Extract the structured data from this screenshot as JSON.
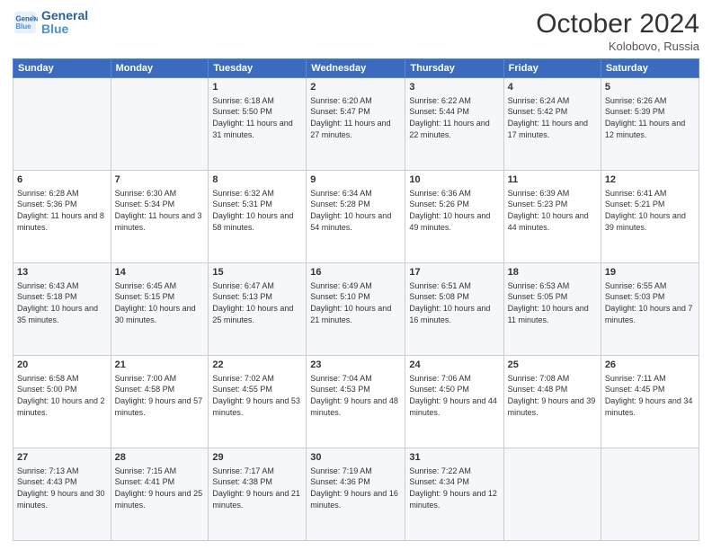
{
  "header": {
    "logo_line1": "General",
    "logo_line2": "Blue",
    "month": "October 2024",
    "location": "Kolobovo, Russia"
  },
  "days_of_week": [
    "Sunday",
    "Monday",
    "Tuesday",
    "Wednesday",
    "Thursday",
    "Friday",
    "Saturday"
  ],
  "weeks": [
    [
      {
        "day": "",
        "sunrise": "",
        "sunset": "",
        "daylight": ""
      },
      {
        "day": "",
        "sunrise": "",
        "sunset": "",
        "daylight": ""
      },
      {
        "day": "1",
        "sunrise": "Sunrise: 6:18 AM",
        "sunset": "Sunset: 5:50 PM",
        "daylight": "Daylight: 11 hours and 31 minutes."
      },
      {
        "day": "2",
        "sunrise": "Sunrise: 6:20 AM",
        "sunset": "Sunset: 5:47 PM",
        "daylight": "Daylight: 11 hours and 27 minutes."
      },
      {
        "day": "3",
        "sunrise": "Sunrise: 6:22 AM",
        "sunset": "Sunset: 5:44 PM",
        "daylight": "Daylight: 11 hours and 22 minutes."
      },
      {
        "day": "4",
        "sunrise": "Sunrise: 6:24 AM",
        "sunset": "Sunset: 5:42 PM",
        "daylight": "Daylight: 11 hours and 17 minutes."
      },
      {
        "day": "5",
        "sunrise": "Sunrise: 6:26 AM",
        "sunset": "Sunset: 5:39 PM",
        "daylight": "Daylight: 11 hours and 12 minutes."
      }
    ],
    [
      {
        "day": "6",
        "sunrise": "Sunrise: 6:28 AM",
        "sunset": "Sunset: 5:36 PM",
        "daylight": "Daylight: 11 hours and 8 minutes."
      },
      {
        "day": "7",
        "sunrise": "Sunrise: 6:30 AM",
        "sunset": "Sunset: 5:34 PM",
        "daylight": "Daylight: 11 hours and 3 minutes."
      },
      {
        "day": "8",
        "sunrise": "Sunrise: 6:32 AM",
        "sunset": "Sunset: 5:31 PM",
        "daylight": "Daylight: 10 hours and 58 minutes."
      },
      {
        "day": "9",
        "sunrise": "Sunrise: 6:34 AM",
        "sunset": "Sunset: 5:28 PM",
        "daylight": "Daylight: 10 hours and 54 minutes."
      },
      {
        "day": "10",
        "sunrise": "Sunrise: 6:36 AM",
        "sunset": "Sunset: 5:26 PM",
        "daylight": "Daylight: 10 hours and 49 minutes."
      },
      {
        "day": "11",
        "sunrise": "Sunrise: 6:39 AM",
        "sunset": "Sunset: 5:23 PM",
        "daylight": "Daylight: 10 hours and 44 minutes."
      },
      {
        "day": "12",
        "sunrise": "Sunrise: 6:41 AM",
        "sunset": "Sunset: 5:21 PM",
        "daylight": "Daylight: 10 hours and 39 minutes."
      }
    ],
    [
      {
        "day": "13",
        "sunrise": "Sunrise: 6:43 AM",
        "sunset": "Sunset: 5:18 PM",
        "daylight": "Daylight: 10 hours and 35 minutes."
      },
      {
        "day": "14",
        "sunrise": "Sunrise: 6:45 AM",
        "sunset": "Sunset: 5:15 PM",
        "daylight": "Daylight: 10 hours and 30 minutes."
      },
      {
        "day": "15",
        "sunrise": "Sunrise: 6:47 AM",
        "sunset": "Sunset: 5:13 PM",
        "daylight": "Daylight: 10 hours and 25 minutes."
      },
      {
        "day": "16",
        "sunrise": "Sunrise: 6:49 AM",
        "sunset": "Sunset: 5:10 PM",
        "daylight": "Daylight: 10 hours and 21 minutes."
      },
      {
        "day": "17",
        "sunrise": "Sunrise: 6:51 AM",
        "sunset": "Sunset: 5:08 PM",
        "daylight": "Daylight: 10 hours and 16 minutes."
      },
      {
        "day": "18",
        "sunrise": "Sunrise: 6:53 AM",
        "sunset": "Sunset: 5:05 PM",
        "daylight": "Daylight: 10 hours and 11 minutes."
      },
      {
        "day": "19",
        "sunrise": "Sunrise: 6:55 AM",
        "sunset": "Sunset: 5:03 PM",
        "daylight": "Daylight: 10 hours and 7 minutes."
      }
    ],
    [
      {
        "day": "20",
        "sunrise": "Sunrise: 6:58 AM",
        "sunset": "Sunset: 5:00 PM",
        "daylight": "Daylight: 10 hours and 2 minutes."
      },
      {
        "day": "21",
        "sunrise": "Sunrise: 7:00 AM",
        "sunset": "Sunset: 4:58 PM",
        "daylight": "Daylight: 9 hours and 57 minutes."
      },
      {
        "day": "22",
        "sunrise": "Sunrise: 7:02 AM",
        "sunset": "Sunset: 4:55 PM",
        "daylight": "Daylight: 9 hours and 53 minutes."
      },
      {
        "day": "23",
        "sunrise": "Sunrise: 7:04 AM",
        "sunset": "Sunset: 4:53 PM",
        "daylight": "Daylight: 9 hours and 48 minutes."
      },
      {
        "day": "24",
        "sunrise": "Sunrise: 7:06 AM",
        "sunset": "Sunset: 4:50 PM",
        "daylight": "Daylight: 9 hours and 44 minutes."
      },
      {
        "day": "25",
        "sunrise": "Sunrise: 7:08 AM",
        "sunset": "Sunset: 4:48 PM",
        "daylight": "Daylight: 9 hours and 39 minutes."
      },
      {
        "day": "26",
        "sunrise": "Sunrise: 7:11 AM",
        "sunset": "Sunset: 4:45 PM",
        "daylight": "Daylight: 9 hours and 34 minutes."
      }
    ],
    [
      {
        "day": "27",
        "sunrise": "Sunrise: 7:13 AM",
        "sunset": "Sunset: 4:43 PM",
        "daylight": "Daylight: 9 hours and 30 minutes."
      },
      {
        "day": "28",
        "sunrise": "Sunrise: 7:15 AM",
        "sunset": "Sunset: 4:41 PM",
        "daylight": "Daylight: 9 hours and 25 minutes."
      },
      {
        "day": "29",
        "sunrise": "Sunrise: 7:17 AM",
        "sunset": "Sunset: 4:38 PM",
        "daylight": "Daylight: 9 hours and 21 minutes."
      },
      {
        "day": "30",
        "sunrise": "Sunrise: 7:19 AM",
        "sunset": "Sunset: 4:36 PM",
        "daylight": "Daylight: 9 hours and 16 minutes."
      },
      {
        "day": "31",
        "sunrise": "Sunrise: 7:22 AM",
        "sunset": "Sunset: 4:34 PM",
        "daylight": "Daylight: 9 hours and 12 minutes."
      },
      {
        "day": "",
        "sunrise": "",
        "sunset": "",
        "daylight": ""
      },
      {
        "day": "",
        "sunrise": "",
        "sunset": "",
        "daylight": ""
      }
    ]
  ]
}
